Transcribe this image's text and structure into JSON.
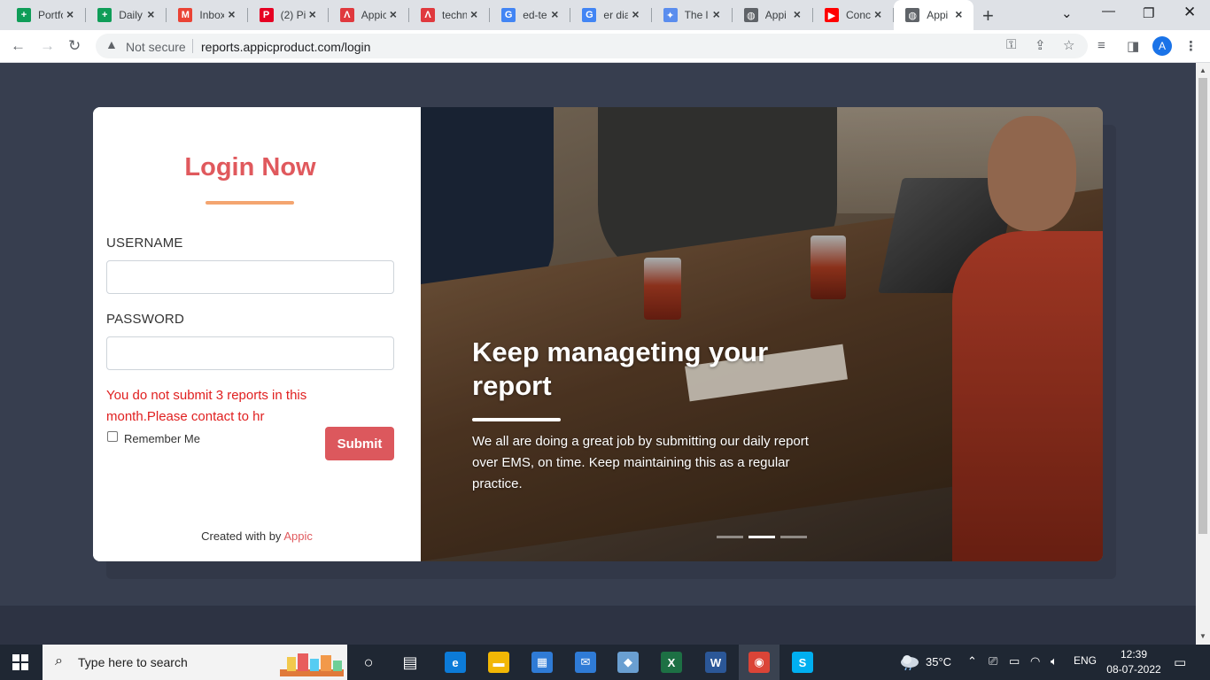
{
  "browser": {
    "tabs": [
      {
        "title": "Portfolio",
        "favicon": "google-sheets-icon",
        "color": "#0f9d58",
        "glyph": "+"
      },
      {
        "title": "Daily",
        "favicon": "google-sheets-icon",
        "color": "#0f9d58",
        "glyph": "+"
      },
      {
        "title": "Inbox",
        "favicon": "gmail-icon",
        "color": "#ea4335",
        "glyph": "M"
      },
      {
        "title": "(2) Pi",
        "favicon": "pinterest-icon",
        "color": "#e60023",
        "glyph": "P"
      },
      {
        "title": "Appic",
        "favicon": "appic-icon",
        "color": "#e0393e",
        "glyph": "Λ"
      },
      {
        "title": "techn",
        "favicon": "appic-icon",
        "color": "#e0393e",
        "glyph": "Λ"
      },
      {
        "title": "ed-te",
        "favicon": "google-icon",
        "color": "#4285f4",
        "glyph": "G"
      },
      {
        "title": "er dia",
        "favicon": "google-icon",
        "color": "#4285f4",
        "glyph": "G"
      },
      {
        "title": "The l",
        "favicon": "tool-icon",
        "color": "#5a8dee",
        "glyph": "✦"
      },
      {
        "title": "Appi",
        "favicon": "globe-icon",
        "color": "#5f6368",
        "glyph": "◍"
      },
      {
        "title": "Conc",
        "favicon": "youtube-icon",
        "color": "#ff0000",
        "glyph": "▶"
      },
      {
        "title": "Appi",
        "favicon": "globe-icon",
        "color": "#5f6368",
        "glyph": "◍",
        "active": true
      }
    ],
    "new_tab": "+",
    "security_label": "Not secure",
    "url": "reports.appicproduct.com/login",
    "profile_initial": "A"
  },
  "login": {
    "title": "Login Now",
    "username_label": "USERNAME",
    "username_value": "",
    "password_label": "PASSWORD",
    "password_value": "",
    "error_message": "You do not submit 3 reports in this month.Please contact to hr",
    "remember_label": "Remember Me",
    "submit_label": "Submit",
    "created_prefix": "Created with by",
    "created_link": "Appic",
    "accent_color": "#e0595d",
    "underline_color": "#f4a570"
  },
  "carousel": {
    "title": "Keep manageting your report",
    "text": "We all are doing a great job by submitting our daily report over EMS, on time. Keep maintaining this as a regular practice.",
    "slide_count": 3,
    "active_slide": 2
  },
  "taskbar": {
    "search_placeholder": "Type here to search",
    "apps": [
      {
        "name": "task-view-icon",
        "glyph": "○"
      },
      {
        "name": "widgets-icon",
        "glyph": "▤"
      },
      {
        "name": "edge-icon",
        "glyph": "e",
        "color": "#0c7bd8"
      },
      {
        "name": "file-explorer-icon",
        "glyph": "▬",
        "color": "#f2b705"
      },
      {
        "name": "store-icon",
        "glyph": "▦",
        "color": "#2f7bd6"
      },
      {
        "name": "mail-icon",
        "glyph": "✉",
        "color": "#2f7bd6"
      },
      {
        "name": "app-icon",
        "glyph": "◆",
        "color": "#6a9fd1"
      },
      {
        "name": "excel-icon",
        "glyph": "X",
        "color": "#1d7044"
      },
      {
        "name": "word-icon",
        "glyph": "W",
        "color": "#2b5797"
      },
      {
        "name": "chrome-icon",
        "glyph": "◉",
        "color": "#db4437"
      },
      {
        "name": "skype-icon",
        "glyph": "S",
        "color": "#00aff0"
      }
    ],
    "temperature": "35°C",
    "language": "ENG",
    "time": "12:39",
    "date": "08-07-2022"
  }
}
